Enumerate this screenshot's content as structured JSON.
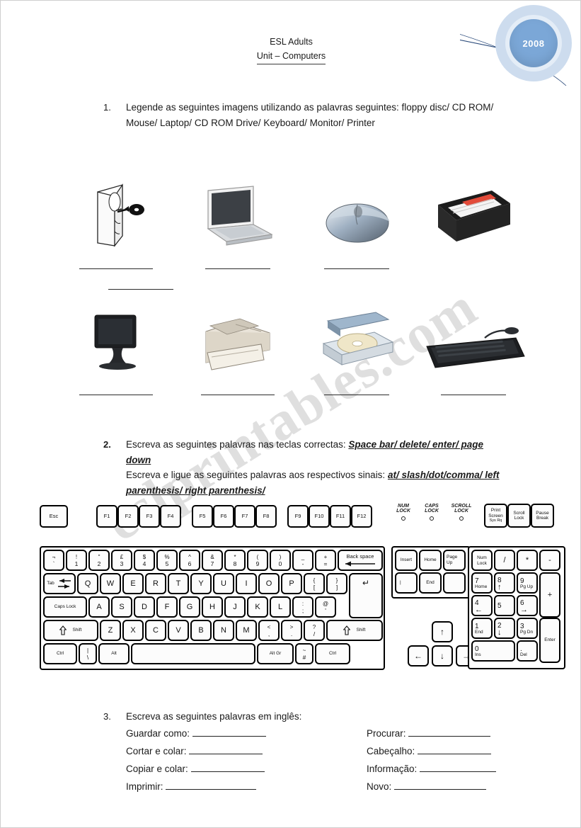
{
  "header": {
    "line1": "ESL Adults",
    "line2": "Unit – Computers",
    "year": "2008"
  },
  "watermark": "eslprintables.com",
  "exercises": [
    {
      "number": "1.",
      "text": "Legende as seguintes imagens utilizando as palavras seguintes: floppy disc/ CD ROM/ Mouse/ Laptop/ CD ROM Drive/ Keyboard/ Monitor/ Printer"
    },
    {
      "number": "2.",
      "line1_plain": "Escreva as seguintes palavras nas teclas correctas: ",
      "line1_keywords": "Space bar/ delete/ enter/ page down",
      "line2_plain": "Escreva e ligue as seguintes palavras aos respectivos sinais: ",
      "line2_keywords": "at/ slash/dot/comma/ left parenthesis/ right parenthesis/"
    },
    {
      "number": "3.",
      "text": "Escreva as seguintes palavras em inglês:",
      "left_items": [
        "Guardar como:",
        "Cortar e colar:",
        "Copiar e colar:",
        "Imprimir:"
      ],
      "right_items": [
        "Procurar:",
        "Cabeçalho:",
        "Informação:",
        "Novo:"
      ]
    }
  ],
  "pictures": {
    "row1": [
      {
        "name": "computer-tower-with-cd-icon",
        "answer_lines": 2
      },
      {
        "name": "laptop-icon",
        "answer_lines": 1
      },
      {
        "name": "mouse-icon",
        "answer_lines": 1
      },
      {
        "name": "floppy-disc-icon",
        "answer_lines": 0
      }
    ],
    "row2": [
      {
        "name": "monitor-icon",
        "answer_lines": 1
      },
      {
        "name": "printer-icon",
        "answer_lines": 1
      },
      {
        "name": "cd-rom-drive-icon",
        "answer_lines": 1
      },
      {
        "name": "keyboard-icon",
        "answer_lines": 1
      }
    ]
  },
  "keyboard": {
    "esc": "Esc",
    "function_keys_1": [
      "F1",
      "F2",
      "F3",
      "F4"
    ],
    "function_keys_2": [
      "F5",
      "F6",
      "F7",
      "F8"
    ],
    "function_keys_3": [
      "F9",
      "F10",
      "F11",
      "F12"
    ],
    "leds": [
      {
        "line1": "NUM",
        "line2": "LOCK"
      },
      {
        "line1": "CAPS",
        "line2": "LOCK"
      },
      {
        "line1": "SCROLL",
        "line2": "LOCK"
      }
    ],
    "sys_keys": [
      {
        "line1": "Print",
        "line2": "Screen",
        "line3": "Sys Rq"
      },
      {
        "line1": "Scroll",
        "line2": "Lock",
        "line3": ""
      },
      {
        "line1": "Pause",
        "line2": "Break",
        "line3": ""
      }
    ],
    "number_row": [
      {
        "top": "¬",
        "bot": "`"
      },
      {
        "top": "!",
        "bot": "1"
      },
      {
        "top": "\"",
        "bot": "2"
      },
      {
        "top": "£",
        "bot": "3"
      },
      {
        "top": "$",
        "bot": "4"
      },
      {
        "top": "%",
        "bot": "5"
      },
      {
        "top": "^",
        "bot": "6"
      },
      {
        "top": "&",
        "bot": "7"
      },
      {
        "top": "*",
        "bot": "8"
      },
      {
        "top": "(",
        "bot": "9"
      },
      {
        "top": ")",
        "bot": "0"
      },
      {
        "top": "_",
        "bot": "-"
      },
      {
        "top": "+",
        "bot": "="
      }
    ],
    "backspace": "Back space",
    "tab": "Tab",
    "qwerty_row": [
      "Q",
      "W",
      "E",
      "R",
      "T",
      "Y",
      "U",
      "I",
      "O",
      "P"
    ],
    "qwerty_sym": [
      {
        "top": "{",
        "bot": "["
      },
      {
        "top": "}",
        "bot": "]"
      }
    ],
    "enter": "↵",
    "caps_lock": "Caps Lock",
    "home_row": [
      "A",
      "S",
      "D",
      "F",
      "G",
      "H",
      "J",
      "K",
      "L"
    ],
    "home_sym": [
      {
        "top": ":",
        "bot": ";"
      },
      {
        "top": "@",
        "bot": "'"
      }
    ],
    "shift": "Shift",
    "bottom_row": [
      "Z",
      "X",
      "C",
      "V",
      "B",
      "N",
      "M"
    ],
    "bottom_sym": [
      {
        "top": "<",
        "bot": ","
      },
      {
        "top": ">",
        "bot": "."
      },
      {
        "top": "?",
        "bot": "/"
      }
    ],
    "ctrl": "Ctrl",
    "backslash": {
      "top": "|",
      "bot": "\\"
    },
    "alt": "Alt",
    "space": "",
    "alt_gr": "Alt Gr",
    "hash": {
      "top": "~",
      "bot": "#"
    },
    "nav_keys": [
      "Insert",
      "Home",
      "Page Up",
      "|",
      "End",
      ""
    ],
    "numpad": {
      "num_lock": "Num Lock",
      "slash": "/",
      "asterisk": "*",
      "minus": "-",
      "plus": "+",
      "enter": "Enter",
      "k7": {
        "num": "7",
        "lab": "Home"
      },
      "k8": {
        "num": "8",
        "lab": "↑"
      },
      "k9": {
        "num": "9",
        "lab": "Pg Up"
      },
      "k4": {
        "num": "4",
        "lab": "←"
      },
      "k5": {
        "num": "5",
        "lab": ""
      },
      "k6": {
        "num": "6",
        "lab": "→"
      },
      "k1": {
        "num": "1",
        "lab": "End"
      },
      "k2": {
        "num": "2",
        "lab": "↓"
      },
      "k3": {
        "num": "3",
        "lab": "Pg Dn"
      },
      "k0": {
        "num": "0",
        "lab": "Ins"
      },
      "kdot": {
        "num": ".",
        "lab": "Del"
      }
    },
    "arrows": {
      "up": "↑",
      "left": "←",
      "down": "↓",
      "right": "→"
    }
  }
}
